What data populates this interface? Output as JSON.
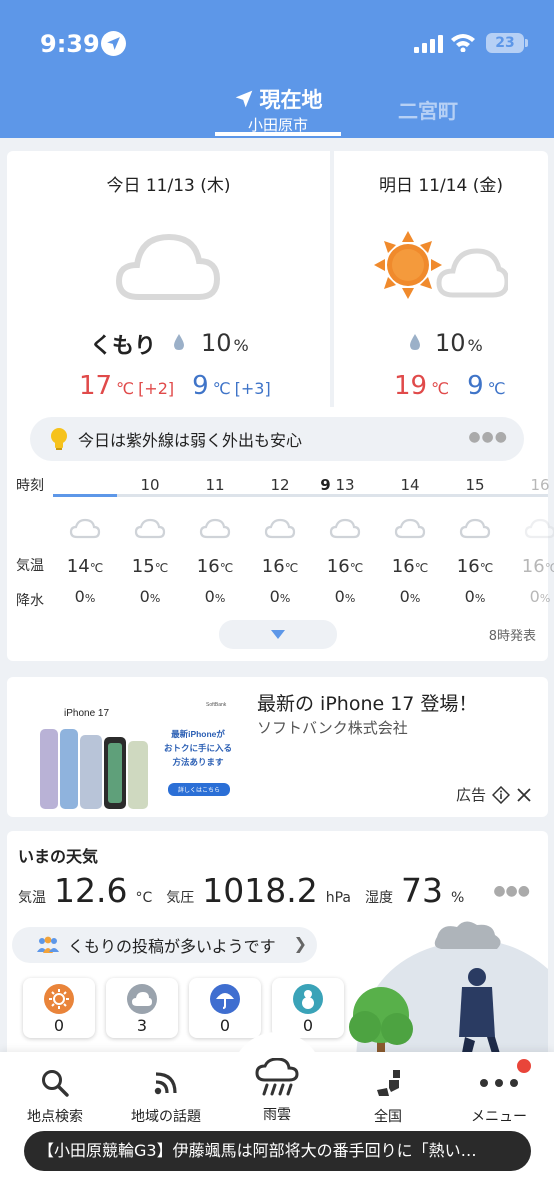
{
  "status_bar": {
    "time": "9:39",
    "battery": "23"
  },
  "header": {
    "current_tab": {
      "label": "現在地",
      "city": "小田原市"
    },
    "other_tab": "二宮町"
  },
  "forecast": {
    "today": {
      "title": "今日 11/13 (木)",
      "condition": "くもり",
      "rain": "10",
      "rain_unit": "%",
      "high": "17",
      "high_diff": "[+2]",
      "low": "9",
      "low_diff": "[+3]",
      "unit": "℃"
    },
    "tomorrow": {
      "title": "明日 11/14 (金)",
      "rain": "10",
      "rain_unit": "%",
      "high": "19",
      "low": "9",
      "unit": "℃"
    },
    "uv_message": "今日は紫外線は弱く外出も安心",
    "row_labels": {
      "hour": "時刻",
      "temp": "気温",
      "precip": "降水"
    },
    "hours": [
      {
        "h": "9",
        "t": "14",
        "p": "0"
      },
      {
        "h": "10",
        "t": "15",
        "p": "0"
      },
      {
        "h": "11",
        "t": "16",
        "p": "0"
      },
      {
        "h": "12",
        "t": "16",
        "p": "0"
      },
      {
        "h": "13",
        "t": "16",
        "p": "0"
      },
      {
        "h": "14",
        "t": "16",
        "p": "0"
      },
      {
        "h": "15",
        "t": "16",
        "p": "0"
      },
      {
        "h": "16",
        "t": "16",
        "p": "0"
      }
    ],
    "issued": "8時発表"
  },
  "ad": {
    "title": "最新の iPhone 17 登場！",
    "advertiser": "ソフトバンク株式会社",
    "label": "広告",
    "image": {
      "product": "iPhone 17",
      "brand": "SoftBank",
      "headline_1": "最新iPhoneが",
      "headline_2": "おトクに手に入る",
      "headline_3": "方法あります",
      "cta": "詳しくはこちら"
    }
  },
  "now": {
    "title": "いまの天気",
    "temp_label": "気温",
    "temp": "12.6",
    "temp_unit": "°C",
    "pressure_label": "気圧",
    "pressure": "1018.2",
    "pressure_unit": "hPa",
    "humidity_label": "湿度",
    "humidity": "73",
    "humidity_unit": "%",
    "post_message": "くもりの投稿が多いようです",
    "reactions": [
      {
        "icon": "sun-icon",
        "count": "0"
      },
      {
        "icon": "cloud-icon",
        "count": "3"
      },
      {
        "icon": "umbrella-icon",
        "count": "0"
      },
      {
        "icon": "snowman-icon",
        "count": "0"
      }
    ]
  },
  "bottom_nav": [
    {
      "label": "地点検索",
      "icon": "search-icon"
    },
    {
      "label": "地域の話題",
      "icon": "rss-icon"
    },
    {
      "label": "雨雲",
      "icon": "rain-cloud-icon"
    },
    {
      "label": "全国",
      "icon": "japan-map-icon"
    },
    {
      "label": "メニュー",
      "icon": "more-icon"
    }
  ],
  "ticker": "【小田原競輪G3】伊藤颯馬は阿部将大の番手回りに「熱い…"
}
